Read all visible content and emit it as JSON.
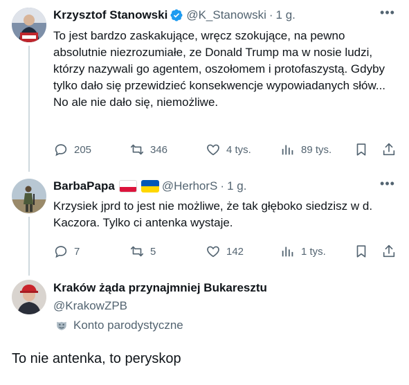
{
  "tweet1": {
    "author_name": "Krzysztof Stanowski",
    "verified": true,
    "handle": "@K_Stanowski",
    "dot": "·",
    "time": "1 g.",
    "text": "To jest bardzo zaskakujące, wręcz szokujące, na pewno absolutnie niezrozumiałe, ze Donald Trump ma w nosie ludzi, którzy nazywali go agentem, oszołomem i protofaszystą. Gdyby tylko dało się przewidzieć konsekwencje wypowiadanych słów... No ale nie dało się, niemożliwe.",
    "replies": "205",
    "reposts": "346",
    "likes": "4 tys.",
    "views": "89 tys."
  },
  "tweet2": {
    "author_name": "BarbaPapa",
    "flags": [
      "poland-flag-icon",
      "ukraine-flag-icon"
    ],
    "handle": "@HerhorS",
    "dot": "·",
    "time": "1 g.",
    "text": "Krzysiek jprd to jest nie możliwe, że tak głęboko siedzisz w d. Kaczora. Tylko ci antenka wystaje.",
    "replies": "7",
    "reposts": "5",
    "likes": "142",
    "views": "1 tys."
  },
  "tweet3": {
    "author_name": "Kraków żąda przynajmniej Bukaresztu",
    "handle": "@KrakowZPB",
    "parody_label": "Konto parodystyczne"
  },
  "reply_text": "To nie antenka, to peryskop",
  "colors": {
    "text_primary": "#0f1419",
    "text_secondary": "#536471",
    "verified_blue": "#1d9bf0",
    "thread_line": "#cfd9de"
  }
}
